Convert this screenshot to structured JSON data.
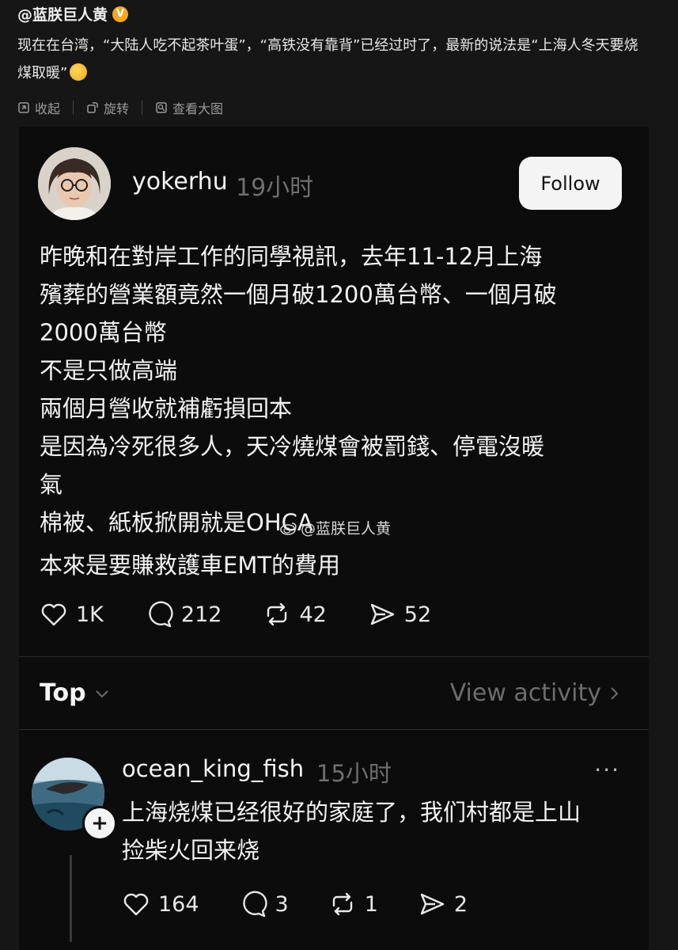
{
  "weibo": {
    "author": "@蓝朕巨人黄",
    "text": "现在在台湾，“大陆人吃不起茶叶蛋”，“高铁没有靠背”已经过时了，最新的说法是“上海人冬天要烧煤取暖”",
    "toolbar": {
      "collapse": "收起",
      "rotate": "旋转",
      "view_large": "查看大图"
    }
  },
  "post": {
    "username": "yokerhu",
    "time": "19小时",
    "follow_label": "Follow",
    "lines": [
      "昨晚和在對岸工作的同學視訊，去年11-12月上海",
      "殯葬的營業額竟然一個月破1200萬台幣、一個月破",
      "2000萬台幣",
      "不是只做高端",
      "兩個月營收就補虧損回本",
      "是因為冷死很多人，天冷燒煤會被罰錢、停電沒暖",
      "氣",
      "棉被、紙板掀開就是OHCA"
    ],
    "last_line": "本來是要賺救護車EMT的費用",
    "watermark": "@蓝朕巨人黄",
    "stats": {
      "likes": "1K",
      "comments": "212",
      "reposts": "42",
      "shares": "52"
    }
  },
  "sort": {
    "label": "Top",
    "view_activity": "View activity"
  },
  "reply": {
    "username": "ocean_king_fish",
    "time": "15小时",
    "more": "···",
    "plus": "+",
    "lines": [
      "上海烧煤已经很好的家庭了，我们村都是上山",
      "捡柴火回来烧"
    ],
    "stats": {
      "likes": "164",
      "comments": "3",
      "reposts": "1",
      "shares": "2"
    }
  },
  "colors": {
    "background": "#161616",
    "card": "#0c0c0c",
    "muted": "#6f6f6f",
    "verified": "#f5a623"
  }
}
